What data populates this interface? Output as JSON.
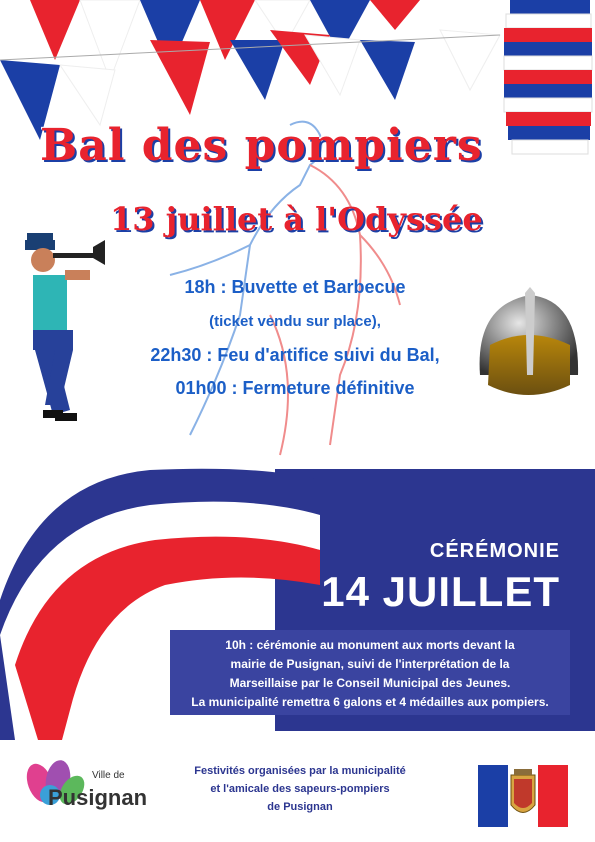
{
  "title": "Bal des pompiers",
  "subtitle": "13 juillet à l'Odyssée",
  "program": [
    "18h : Buvette et Barbecue",
    "(ticket vendu sur place),",
    "22h30 : Feu d'artifice suivi du Bal,",
    "01h00 : Fermeture définitive"
  ],
  "ceremony": {
    "label": "CÉRÉMONIE",
    "date": "14 JUILLET",
    "description": [
      "10h : cérémonie au monument aux morts devant la",
      "mairie de Pusignan, suivi de l'interprétation de la",
      "Marseillaise par le Conseil Municipal des Jeunes.",
      "La municipalité remettra 6 galons et 4 médailles aux pompiers."
    ]
  },
  "logo": {
    "prefix": "Ville de",
    "name": "Pusignan"
  },
  "footer": [
    "Festivités organisées par la municipalité",
    "et l'amicale des sapeurs-pompiers",
    "de Pusignan"
  ],
  "colors": {
    "blue": "#1b3fa6",
    "red": "#e8232e",
    "navy_band": "#2c3690",
    "program_text": "#1c5fc7"
  }
}
